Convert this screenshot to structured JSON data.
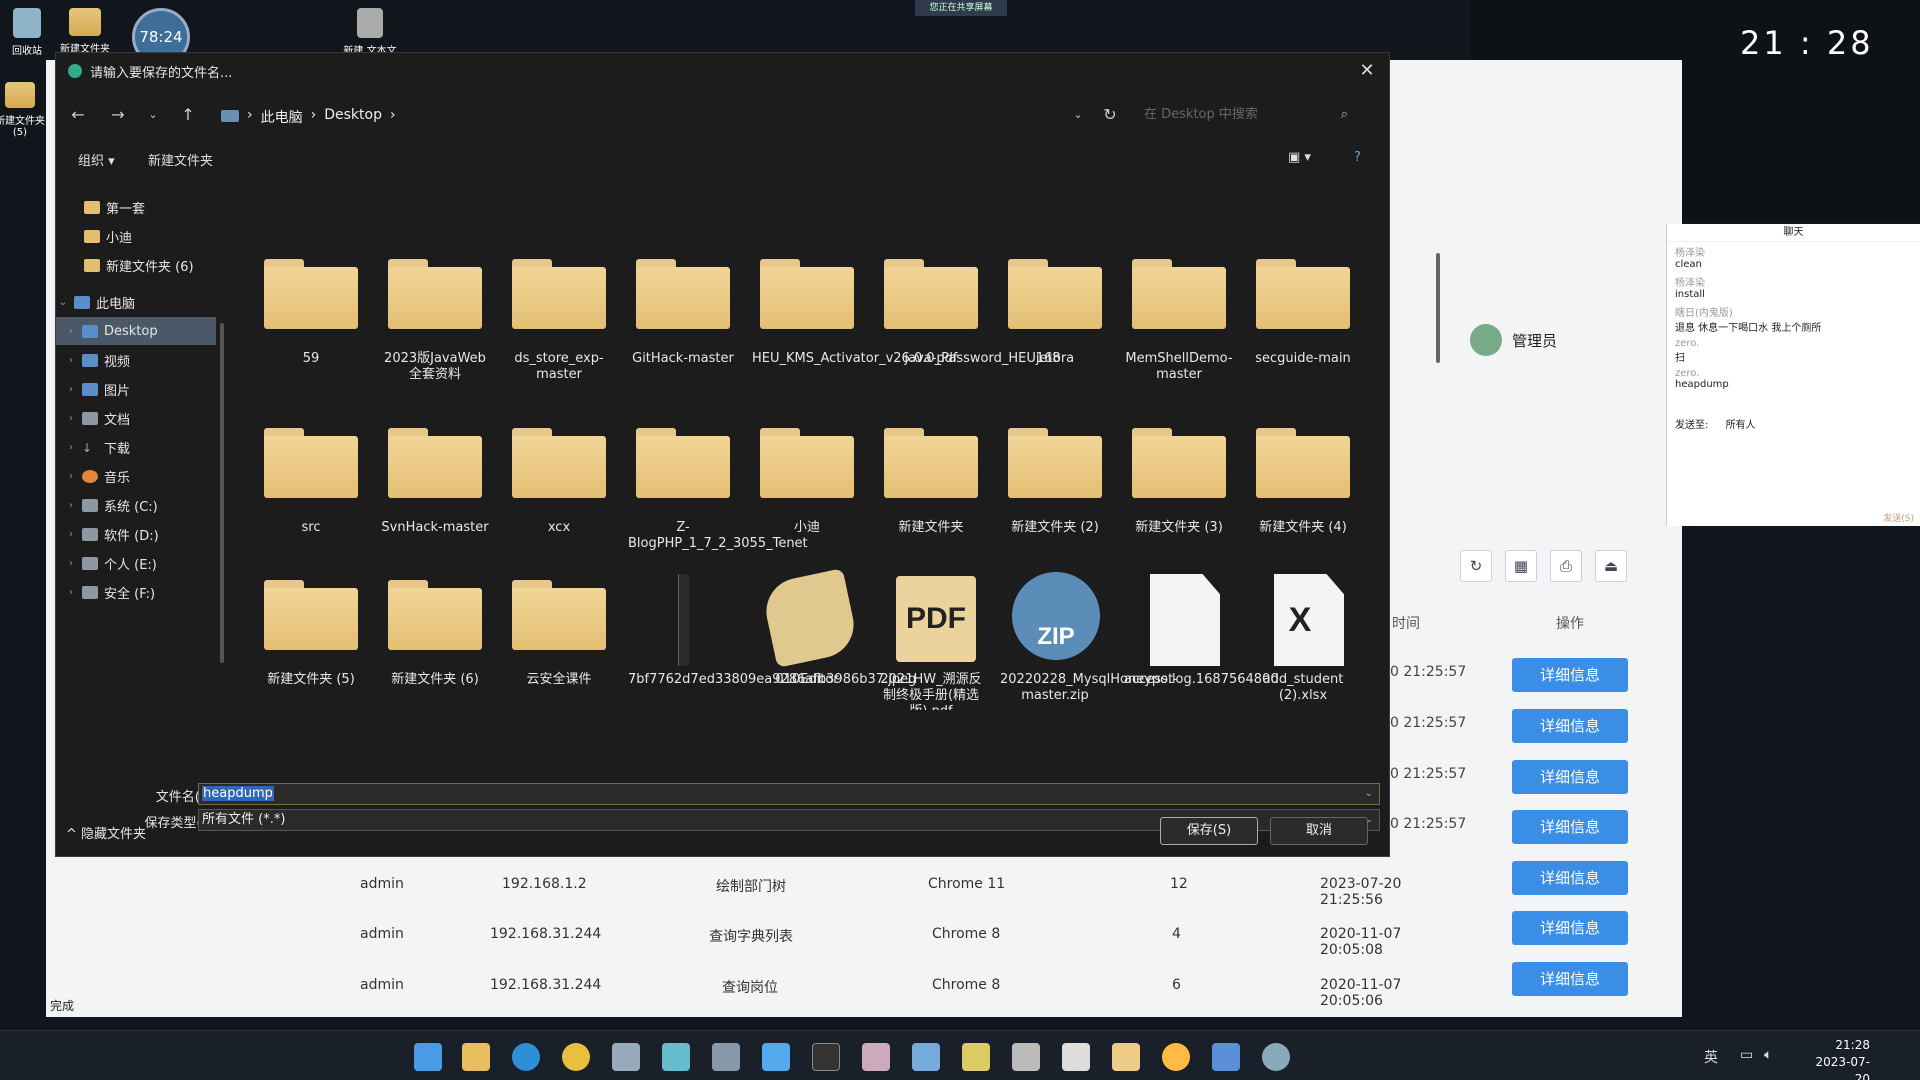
{
  "desktop": {
    "icons": [
      {
        "label": "回收站"
      },
      {
        "label": "新建文件夹"
      },
      {
        "label": "新建 文本文"
      },
      {
        "label": "新建文件夹 (5)"
      }
    ],
    "timer": "78:24",
    "share_banner": "您正在共享屏幕",
    "clock_big": "21 : 28"
  },
  "browser": {
    "status": "完成",
    "admin_name": "管理员",
    "col_time": "时间",
    "col_ops": "操作",
    "detail_label": "详细信息",
    "times": [
      "0 21:25:57",
      "0 21:25:57",
      "0 21:25:57",
      "0 21:25:57"
    ],
    "rows": [
      {
        "user": "admin",
        "ip": "192.168.1.2",
        "op": "绘制部门树",
        "browser": "Chrome 11",
        "n": "12",
        "time": "2023-07-20 21:25:56"
      },
      {
        "user": "admin",
        "ip": "192.168.31.244",
        "op": "查询字典列表",
        "browser": "Chrome 8",
        "n": "4",
        "time": "2020-11-07 20:05:08"
      },
      {
        "user": "admin",
        "ip": "192.168.31.244",
        "op": "查询岗位",
        "browser": "Chrome 8",
        "n": "6",
        "time": "2020-11-07 20:05:06"
      }
    ]
  },
  "chat": {
    "title": "聊天",
    "lines": [
      {
        "name": "杨泽染",
        "text": "clean"
      },
      {
        "name": "杨泽染",
        "text": "install"
      },
      {
        "name": "瞎日(内鬼版)",
        "text": "退息 休息一下喝口水 我上个厕所"
      },
      {
        "name": "zero.",
        "text": "扫"
      },
      {
        "name": "zero.",
        "text": "heapdump"
      }
    ],
    "send_to": "发送至:",
    "send_target": "所有人",
    "send_button": "发送(S)"
  },
  "dialog": {
    "title": "请输入要保存的文件名...",
    "breadcrumb": [
      "此电脑",
      "Desktop"
    ],
    "search_placeholder": "在 Desktop 中搜索",
    "toolbar": {
      "organize": "组织 ▾",
      "new_folder": "新建文件夹"
    },
    "tree": [
      {
        "label": "第一套"
      },
      {
        "label": "小迪"
      },
      {
        "label": "新建文件夹 (6)"
      },
      {
        "label": "此电脑"
      },
      {
        "label": "Desktop"
      },
      {
        "label": "视频"
      },
      {
        "label": "图片"
      },
      {
        "label": "文档"
      },
      {
        "label": "下载"
      },
      {
        "label": "音乐"
      },
      {
        "label": "系统 (C:)"
      },
      {
        "label": "软件 (D:)"
      },
      {
        "label": "个人 (E:)"
      },
      {
        "label": "安全 (F:)"
      }
    ],
    "files": [
      {
        "name": "59"
      },
      {
        "name": "2023版JavaWeb全套资料"
      },
      {
        "name": "ds_store_exp-master"
      },
      {
        "name": "GitHack-master"
      },
      {
        "name": "HEU_KMS_Activator_v26.0.0_Password_HEU168"
      },
      {
        "name": "java-pdf"
      },
      {
        "name": "jetbra"
      },
      {
        "name": "MemShellDemo-master"
      },
      {
        "name": "secguide-main"
      },
      {
        "name": "src"
      },
      {
        "name": "SvnHack-master"
      },
      {
        "name": "xcx"
      },
      {
        "name": "Z-BlogPHP_1_7_2_3055_Tenet"
      },
      {
        "name": "小迪"
      },
      {
        "name": "新建文件夹"
      },
      {
        "name": "新建文件夹 (2)"
      },
      {
        "name": "新建文件夹 (3)"
      },
      {
        "name": "新建文件夹 (4)"
      },
      {
        "name": "新建文件夹 (5)"
      },
      {
        "name": "新建文件夹 (6)"
      },
      {
        "name": "云安全课件"
      },
      {
        "name": "7bf7762d7ed33809ea9286afb3986b37.jpeg"
      },
      {
        "name": "010Editor"
      },
      {
        "name": "2021HW_溯源反制终极手册(精选版).pdf"
      },
      {
        "name": "20220228_MysqlHoneypot-master.zip"
      },
      {
        "name": "access.log.1687564800"
      },
      {
        "name": "add_student (2).xlsx"
      }
    ],
    "filename_label": "文件名(N):",
    "filename_value": "heapdump",
    "filetype_label": "保存类型(T):",
    "filetype_value": "所有文件 (*.*)",
    "hide_folders": "隐藏文件夹",
    "save_button": "保存(S)",
    "cancel_button": "取消"
  },
  "taskbar": {
    "ime": "英",
    "time": "21:28",
    "date": "2023-07-20"
  }
}
